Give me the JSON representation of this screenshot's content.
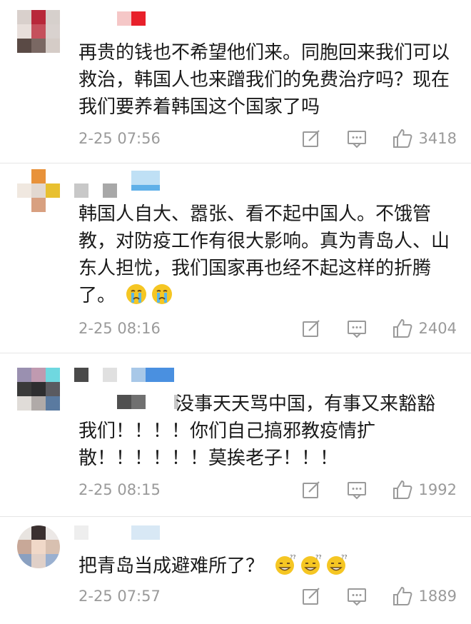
{
  "comments": [
    {
      "text": "再贵的钱也不希望他们来。同胞回来我们可以救治，韩国人也来蹭我们的免费治疗吗？现在我们要养着韩国这个国家了吗",
      "time": "2-25 07:56",
      "likes": "3418",
      "emojis": []
    },
    {
      "text": "韩国人自大、嚣张、看不起中国人。不饿管教，对防疫工作有很大影响。真为青岛人、山东人担忧，我们国家再也经不起这样的折腾了。",
      "time": "2-25 08:16",
      "likes": "2404",
      "emojis": [
        "crying-face",
        "crying-face"
      ]
    },
    {
      "text": "没事天天骂中国，有事又来豁豁我们！！！！你们自己搞邪教疫情扩散！！！！！！莫挨老子！！！",
      "time": "2-25 08:15",
      "likes": "1992",
      "emojis": []
    },
    {
      "text": "把青岛当成避难所了？",
      "time": "2-25 07:57",
      "likes": "1889",
      "emojis": [
        "thinking-grin-face",
        "thinking-grin-face",
        "thinking-grin-face"
      ]
    }
  ],
  "icons": {
    "edit": "edit-icon",
    "reply": "comment-icon",
    "like": "thumbs-up-icon"
  },
  "colors": {
    "text": "#1a1a1a",
    "meta": "#9a9a9a",
    "divider": "#e6e6e6",
    "emoji": "#f5c623"
  }
}
